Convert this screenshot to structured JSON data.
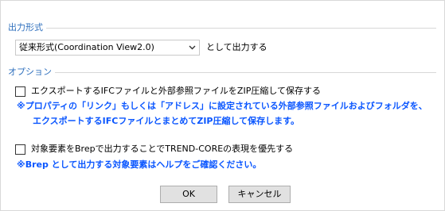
{
  "output_format": {
    "group_title": "出力形式",
    "selected_value": "従来形式(Coordination View2.0)",
    "suffix": "として出力する"
  },
  "options": {
    "group_title": "オプション",
    "zip_checkbox": {
      "label": "エクスポートするIFCファイルと外部参照ファイルをZIP圧縮して保存する",
      "checked": false
    },
    "zip_note_line1": "※プロパティの「リンク」もしくは「アドレス」に設定されている外部参照ファイルおよびフォルダを、",
    "zip_note_line2": "エクスポートするIFCファイルとまとめてZIP圧縮して保存します。",
    "brep_checkbox": {
      "label": "対象要素をBrepで出力することでTREND-COREの表現を優先する",
      "checked": false
    },
    "brep_note": "※Brep として出力する対象要素はヘルプをご確認ください。"
  },
  "buttons": {
    "ok": "OK",
    "cancel": "キャンセル"
  },
  "colors": {
    "group_title": "#2e6fbd",
    "note_text": "#0a56ff"
  },
  "icons": {
    "dropdown": "chevron-down-icon"
  }
}
